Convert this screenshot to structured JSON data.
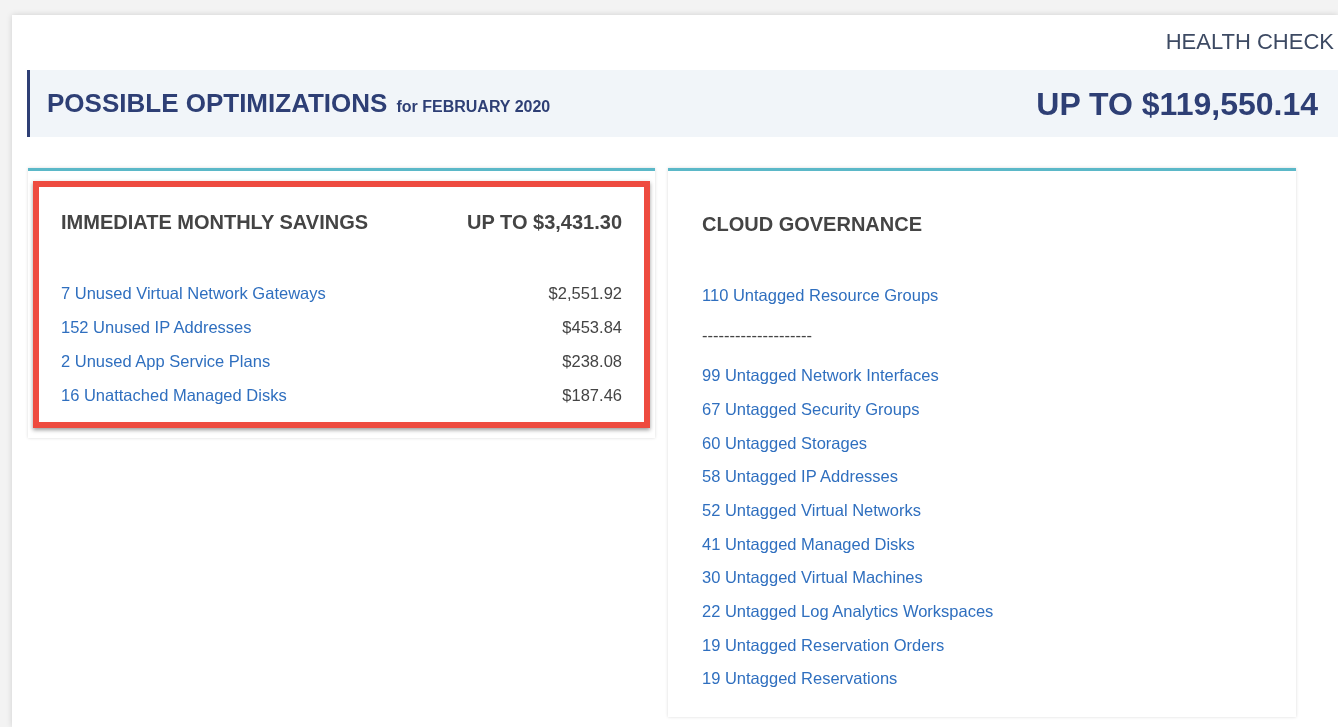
{
  "top_link": "HEALTH CHECK",
  "header": {
    "title": "POSSIBLE OPTIMIZATIONS",
    "subtitle": "for FEBRUARY 2020",
    "total": "UP TO $119,550.14"
  },
  "savings": {
    "title": "IMMEDIATE MONTHLY SAVINGS",
    "total": "UP TO $3,431.30",
    "highlighted": true,
    "items": [
      {
        "label": "7 Unused Virtual Network Gateways",
        "amount": "$2,551.92"
      },
      {
        "label": "152 Unused IP Addresses",
        "amount": "$453.84"
      },
      {
        "label": "2 Unused App Service Plans",
        "amount": "$238.08"
      },
      {
        "label": "16 Unattached Managed Disks",
        "amount": "$187.46"
      }
    ]
  },
  "governance": {
    "title": "CLOUD GOVERNANCE",
    "items": [
      {
        "kind": "link",
        "label": "110 Untagged Resource Groups"
      },
      {
        "kind": "separator",
        "label": "--------------------"
      },
      {
        "kind": "link",
        "label": "99 Untagged Network Interfaces"
      },
      {
        "kind": "link",
        "label": "67 Untagged Security Groups"
      },
      {
        "kind": "link",
        "label": "60 Untagged Storages"
      },
      {
        "kind": "link",
        "label": "58 Untagged IP Addresses"
      },
      {
        "kind": "link",
        "label": "52 Untagged Virtual Networks"
      },
      {
        "kind": "link",
        "label": "41 Untagged Managed Disks"
      },
      {
        "kind": "link",
        "label": "30 Untagged Virtual Machines"
      },
      {
        "kind": "link",
        "label": "22 Untagged Log Analytics Workspaces"
      },
      {
        "kind": "link",
        "label": "19 Untagged Reservation Orders"
      },
      {
        "kind": "link",
        "label": "19 Untagged Reservations"
      }
    ]
  }
}
